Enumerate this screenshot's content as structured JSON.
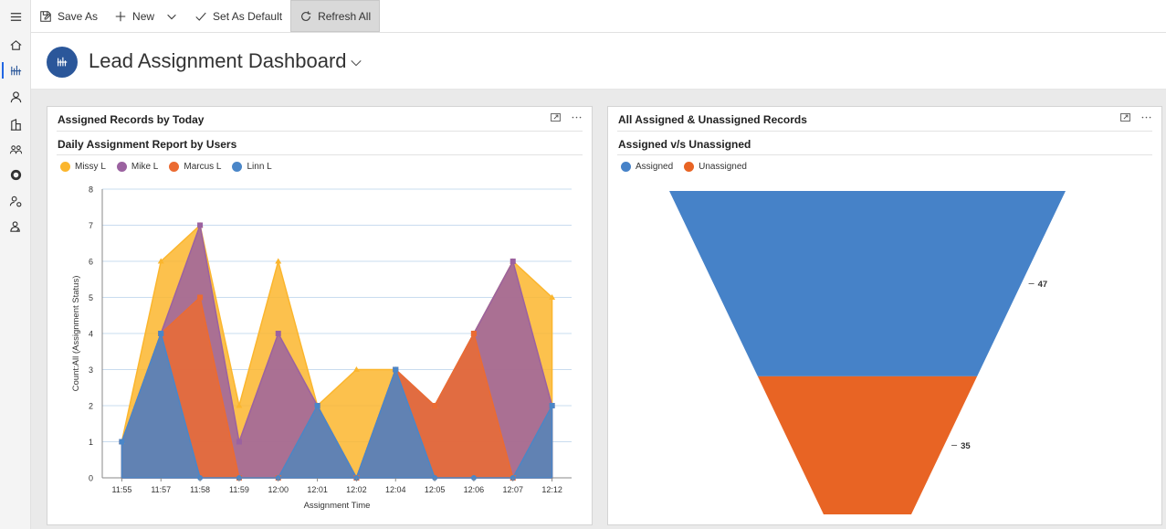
{
  "commandbar": {
    "save_as": "Save As",
    "new": "New",
    "set_as_default": "Set As Default",
    "refresh_all": "Refresh All"
  },
  "header": {
    "title": "Lead Assignment Dashboard"
  },
  "cards": [
    {
      "title": "Assigned Records by Today",
      "chart_title": "Daily Assignment Report by Users"
    },
    {
      "title": "All Assigned & Unassigned Records",
      "chart_title": "Assigned v/s Unassigned"
    }
  ],
  "chart_data": [
    {
      "type": "area",
      "ylabel": "Count:All (Assignment Status)",
      "xlabel": "Assignment Time",
      "ylim": [
        0,
        8
      ],
      "yticks": [
        0,
        1,
        2,
        3,
        4,
        5,
        6,
        7,
        8
      ],
      "grid": true,
      "legend_position": "top-left",
      "categories": [
        "11:55",
        "11:57",
        "11:58",
        "11:59",
        "12:00",
        "12:01",
        "12:02",
        "12:04",
        "12:05",
        "12:06",
        "12:07",
        "12:12"
      ],
      "series": [
        {
          "name": "Missy L",
          "color": "#fbb62e",
          "values": [
            1,
            6,
            7,
            2,
            6,
            2,
            3,
            3,
            2,
            4,
            6,
            5
          ]
        },
        {
          "name": "Mike L",
          "color": "#9b62a0",
          "values": [
            1,
            4,
            7,
            1,
            4,
            2,
            0,
            3,
            2,
            4,
            6,
            2
          ]
        },
        {
          "name": "Marcus L",
          "color": "#eb6b32",
          "values": [
            1,
            4,
            5,
            0,
            0,
            2,
            0,
            3,
            2,
            4,
            0,
            2
          ]
        },
        {
          "name": "Linn L",
          "color": "#4a86c8",
          "values": [
            1,
            4,
            0,
            0,
            0,
            2,
            0,
            3,
            0,
            0,
            0,
            2
          ]
        }
      ]
    },
    {
      "type": "funnel",
      "legend_position": "top-left",
      "categories": [
        "Assigned",
        "Unassigned"
      ],
      "values": [
        47,
        35
      ],
      "colors": [
        "#4682c8",
        "#e86424"
      ]
    }
  ]
}
